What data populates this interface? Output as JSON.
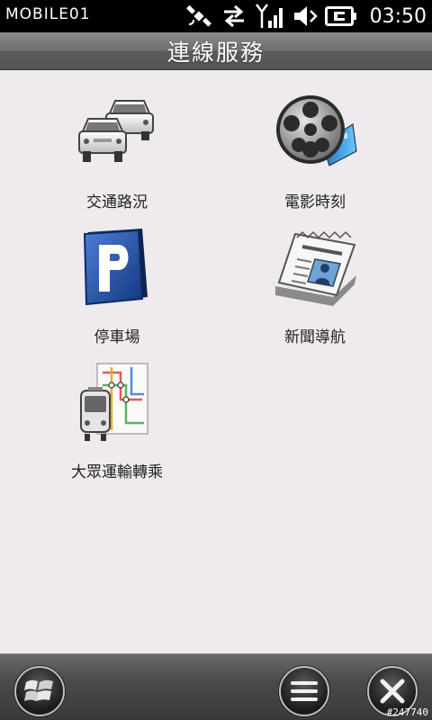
{
  "status_bar": {
    "brand": "MOBILE01",
    "time": "03:50",
    "icons": [
      "satellite-icon",
      "data-transfer-icon",
      "signal-icon",
      "volume-icon",
      "battery-icon"
    ]
  },
  "title": "連線服務",
  "items": [
    {
      "label": "交通路況",
      "icon": "traffic-cars-icon"
    },
    {
      "label": "電影時刻",
      "icon": "film-reel-icon"
    },
    {
      "label": "停車場",
      "icon": "parking-icon"
    },
    {
      "label": "新聞導航",
      "icon": "newspaper-icon"
    },
    {
      "label": "大眾運輸轉乘",
      "icon": "transit-map-icon"
    }
  ],
  "bottom_bar": {
    "start": "windows-start-icon",
    "menu": "menu-icon",
    "close": "close-icon",
    "watermark": "#247740"
  },
  "colors": {
    "background": "#eeeaed",
    "title_bar": "#6e6e6e",
    "status_bar": "#000000",
    "parking_blue": "#1f4fa8"
  }
}
